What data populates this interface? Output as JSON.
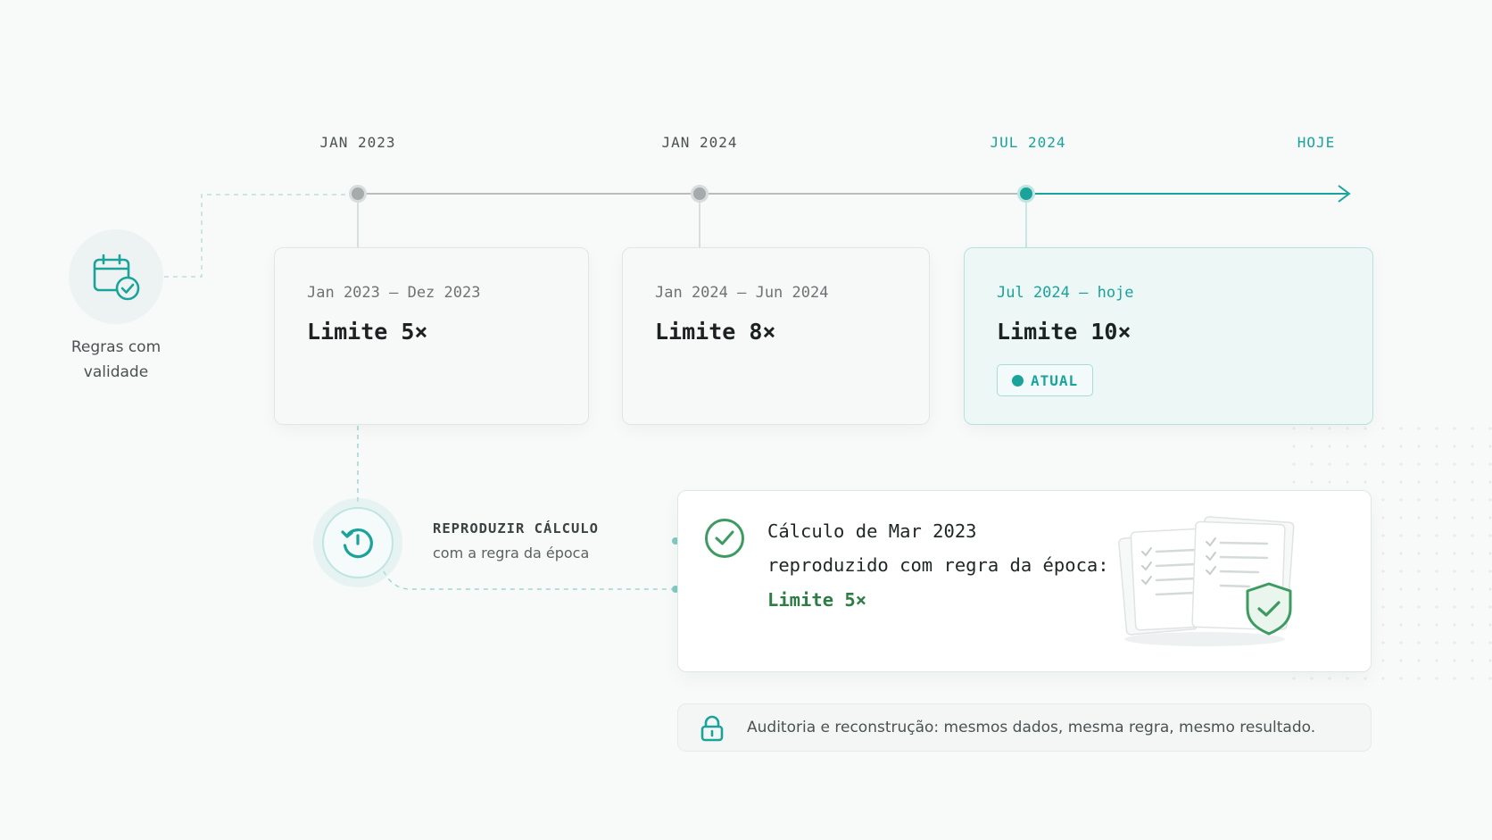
{
  "timeline": {
    "labels": [
      "JAN 2023",
      "JAN 2024",
      "JUL 2024",
      "HOJE"
    ]
  },
  "side": {
    "rules_label": "Regras com validade",
    "icon": "calendar-check-icon"
  },
  "cards": [
    {
      "period": "Jan 2023 – Dez 2023",
      "limit": "Limite 5×"
    },
    {
      "period": "Jan 2024 – Jun 2024",
      "limit": "Limite 8×"
    },
    {
      "period": "Jul 2024 – hoje",
      "limit": "Limite 10×",
      "badge": "ATUAL"
    }
  ],
  "replay": {
    "title": "REPRODUZIR CÁLCULO",
    "subtitle": "com a regra da época",
    "icon": "history-icon"
  },
  "result": {
    "line1": "Cálculo de Mar 2023",
    "line2": "reproduzido com regra da época:",
    "line3": "Limite 5×",
    "icon": "check-circle-icon"
  },
  "audit": {
    "text": "Auditoria e reconstrução: mesmos dados, mesma regra, mesmo resultado.",
    "icon": "lock-icon"
  },
  "colors": {
    "accent": "#1aa39b",
    "success": "#2e7d45",
    "neutral": "#9aa0a0"
  }
}
